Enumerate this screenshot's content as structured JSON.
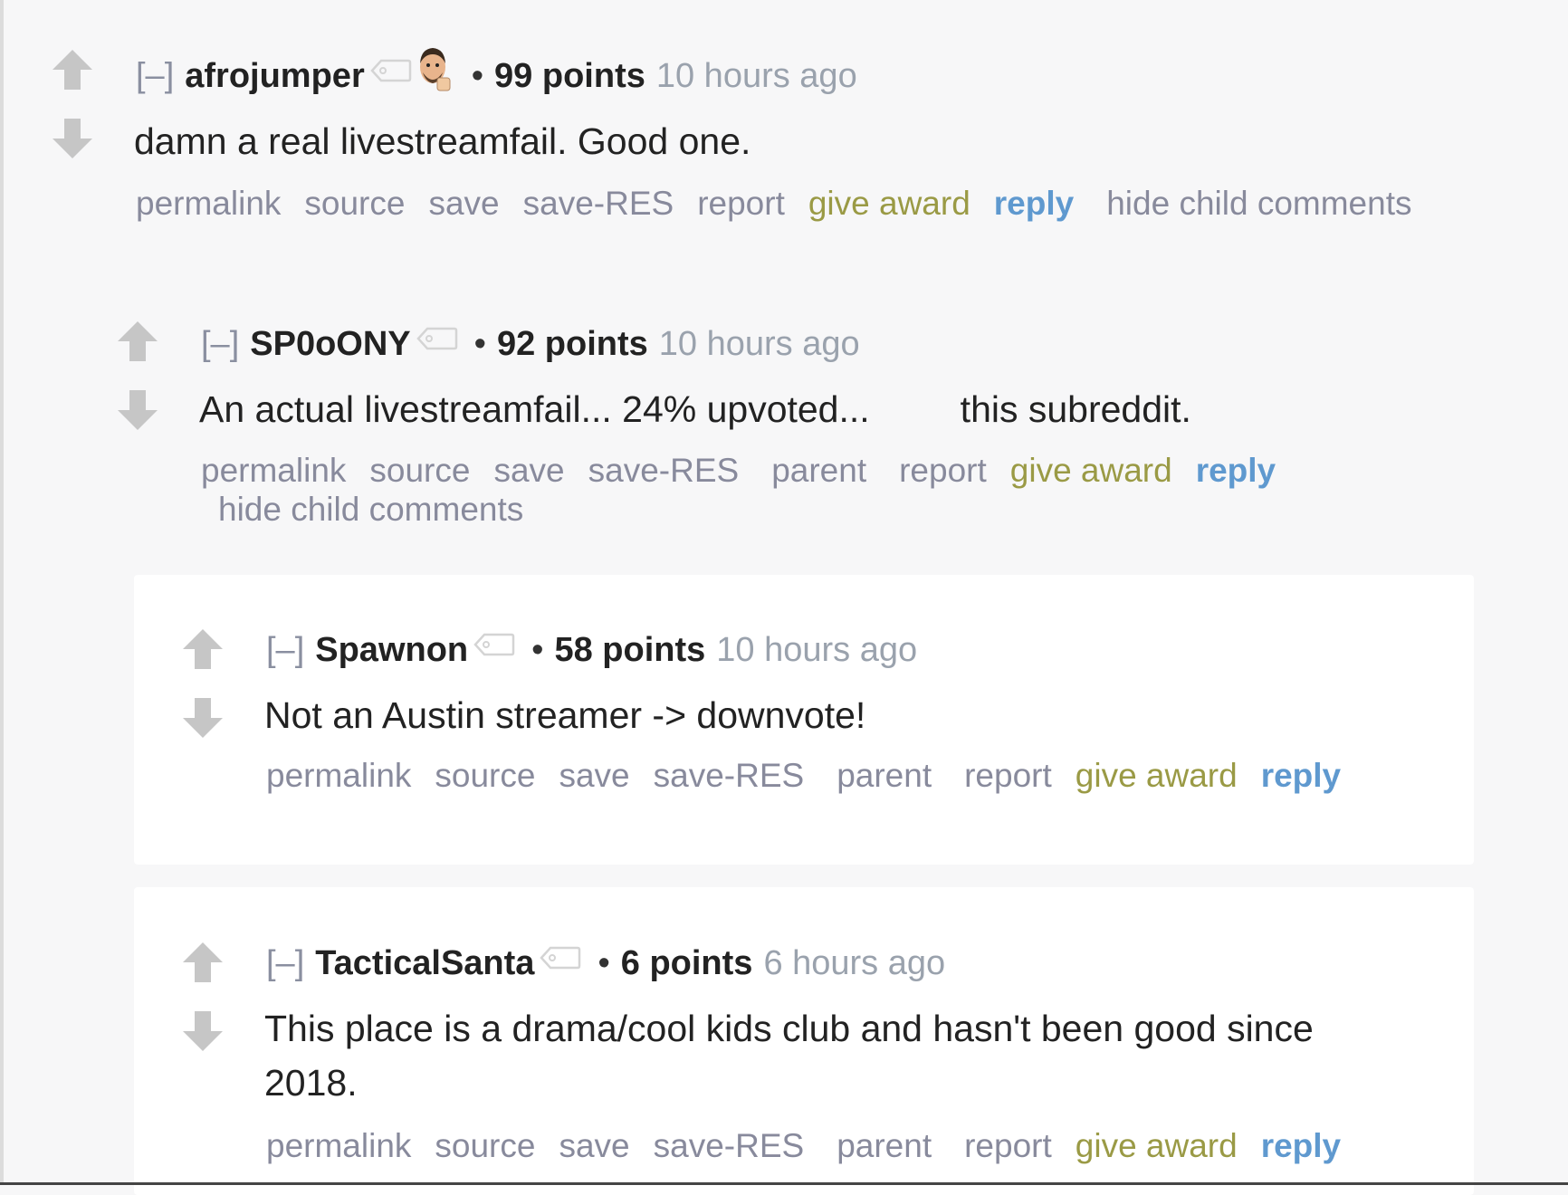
{
  "colors": {
    "page_bg": "#f7f7f8",
    "card_bg": "#ffffff",
    "author": "#222222",
    "meta": "#9aa2ad",
    "action": "#888a9c",
    "award": "#9a9a45",
    "reply": "#5f99cf",
    "vote_arrow": "#c6c6c6"
  },
  "icons": {
    "upvote": "upvote-arrow-icon",
    "downvote": "downvote-arrow-icon",
    "user_tag": "user-tag-icon",
    "flair": "avatar-flair-icon"
  },
  "comments": [
    {
      "collapse": "[–]",
      "author": "afrojumper",
      "bullet": "•",
      "score": "99 points",
      "time": "10 hours ago",
      "body": "damn a real livestreamfail. Good one.",
      "actions": {
        "permalink": "permalink",
        "source": "source",
        "save": "save",
        "save_res": "save-RES",
        "report": "report",
        "give_award": "give award",
        "reply": "reply",
        "hide_child": "hide child comments"
      }
    },
    {
      "collapse": "[–]",
      "author": "SP0oONY",
      "bullet": "•",
      "score": "92 points",
      "time": "10 hours ago",
      "body_start": "An actual livestreamfail... 24% upvoted...",
      "body_end": "this subreddit.",
      "actions": {
        "permalink": "permalink",
        "source": "source",
        "save": "save",
        "save_res": "save-RES",
        "parent": "parent",
        "report": "report",
        "give_award": "give award",
        "reply": "reply",
        "hide_child": "hide child comments"
      }
    },
    {
      "collapse": "[–]",
      "author": "Spawnon",
      "bullet": "•",
      "score": "58 points",
      "time": "10 hours ago",
      "body": "Not an Austin streamer -> downvote!",
      "actions": {
        "permalink": "permalink",
        "source": "source",
        "save": "save",
        "save_res": "save-RES",
        "parent": "parent",
        "report": "report",
        "give_award": "give award",
        "reply": "reply"
      }
    },
    {
      "collapse": "[–]",
      "author": "TacticalSanta",
      "bullet": "•",
      "score": "6 points",
      "time": "6 hours ago",
      "body_line1": "This place is a drama/cool kids club and hasn't been good since",
      "body_line2": "2018.",
      "actions": {
        "permalink": "permalink",
        "source": "source",
        "save": "save",
        "save_res": "save-RES",
        "parent": "parent",
        "report": "report",
        "give_award": "give award",
        "reply": "reply"
      }
    }
  ]
}
